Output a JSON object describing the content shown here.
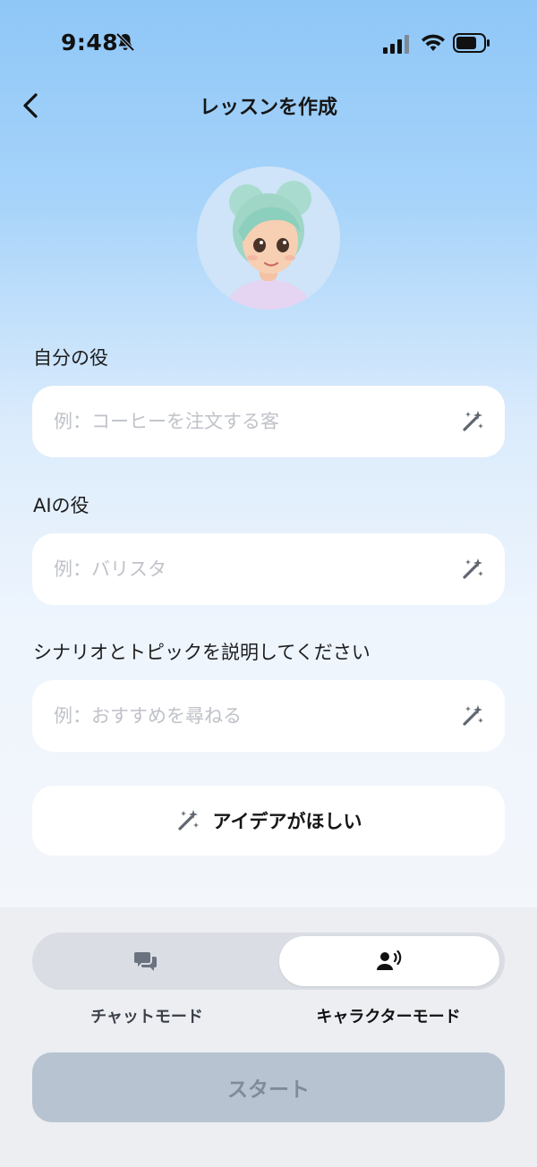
{
  "status_bar": {
    "time": "9:48"
  },
  "header": {
    "title": "レッスンを作成"
  },
  "form": {
    "self_role": {
      "label": "自分の役",
      "value": "",
      "placeholder": "例：コーヒーを注文する客"
    },
    "ai_role": {
      "label": "AIの役",
      "value": "",
      "placeholder": "例：バリスタ"
    },
    "scenario": {
      "label": "シナリオとトピックを説明してください",
      "value": "",
      "placeholder": "例：おすすめを尋ねる"
    }
  },
  "idea_button": {
    "label": "アイデアがほしい"
  },
  "modes": {
    "chat": {
      "label": "チャットモード",
      "selected": false
    },
    "character": {
      "label": "キャラクターモード",
      "selected": true
    }
  },
  "start_button": {
    "label": "スタート"
  },
  "colors": {
    "accent_disabled": "#b7c3d1",
    "background_top": "#8fc7f7",
    "panel": "#eceef2"
  },
  "icons": [
    "bell-slash-icon",
    "signal-icon",
    "wifi-icon",
    "battery-icon",
    "back-chevron-icon",
    "magic-wand-icon",
    "chat-bubbles-icon",
    "speaking-person-icon"
  ]
}
